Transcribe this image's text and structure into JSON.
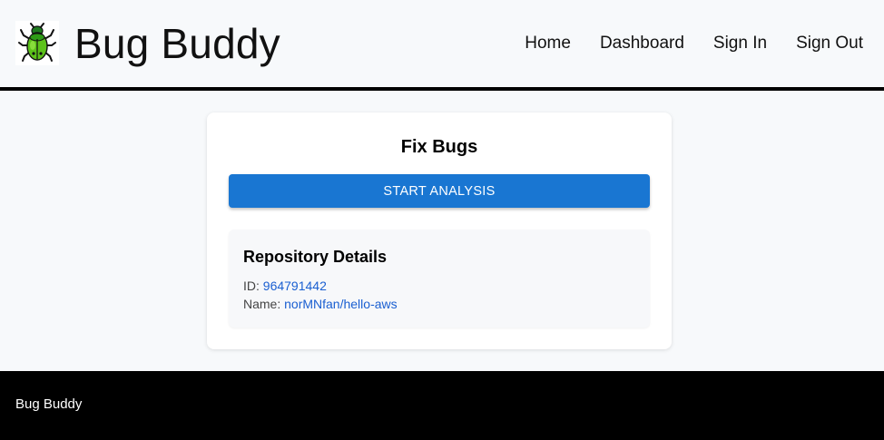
{
  "header": {
    "brand": "Bug Buddy",
    "logo_icon": "green-beetle-icon",
    "nav": [
      {
        "label": "Home"
      },
      {
        "label": "Dashboard"
      },
      {
        "label": "Sign In"
      },
      {
        "label": "Sign Out"
      }
    ]
  },
  "card": {
    "title": "Fix Bugs",
    "start_button_label": "START ANALYSIS",
    "repo": {
      "title": "Repository Details",
      "id_label": "ID:",
      "id_value": "964791442",
      "name_label": "Name:",
      "name_value": "norMNfan/hello-aws"
    }
  },
  "footer": {
    "brand": "Bug Buddy"
  },
  "colors": {
    "page_bg": "#f7f9fb",
    "primary_button": "#1976d2",
    "link_value": "#1a5fd1",
    "footer_bg": "#000000"
  }
}
